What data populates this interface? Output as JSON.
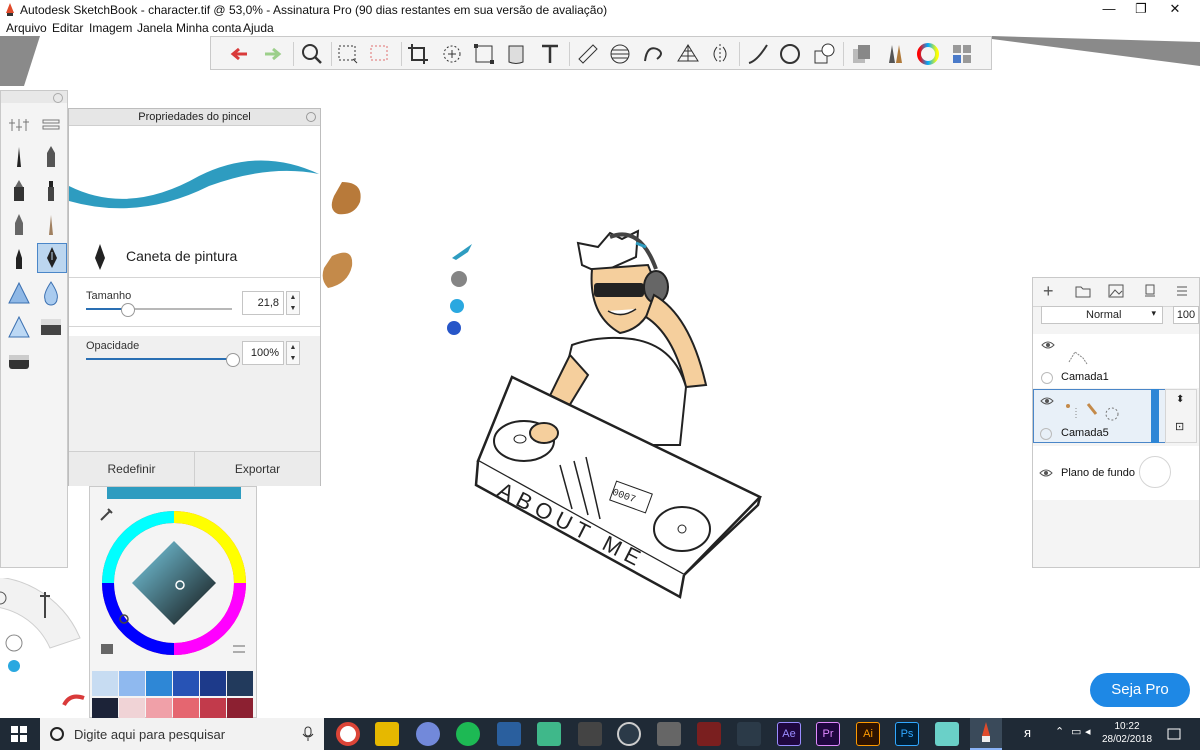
{
  "window": {
    "title": "Autodesk SketchBook - character.tif @ 53,0% - Assinatura Pro (90 dias restantes em sua versão de avaliação)",
    "controls": {
      "minimize": "—",
      "restore": "❐",
      "close": "✕"
    }
  },
  "menu": [
    "Arquivo",
    "Editar",
    "Imagem",
    "Janela",
    "Minha conta",
    "Ajuda"
  ],
  "toolbar": {
    "tools": [
      "undo-icon",
      "redo-icon",
      "zoom-icon",
      "select-rect-icon",
      "lasso-icon",
      "crop-icon",
      "transform-icon",
      "distort-icon",
      "fill-icon",
      "text-icon",
      "ruler-icon",
      "ellipse-guide-icon",
      "french-curve-icon",
      "perspective-icon",
      "symmetry-icon",
      "stroke-icon",
      "ellipse-icon",
      "shapes-icon",
      "copy-icon",
      "brushes-icon",
      "color-wheel-icon",
      "panels-icon"
    ]
  },
  "brush_props": {
    "header": "Propriedades do pincel",
    "brush_name": "Caneta de pintura",
    "size_label": "Tamanho",
    "size_value": "21,8",
    "size_fraction": 0.28,
    "opacity_label": "Opacidade",
    "opacity_value": "100%",
    "opacity_fraction": 1.0,
    "reset_label": "Redefinir",
    "export_label": "Exportar",
    "stroke_color": "#2e9cc0"
  },
  "color_panel": {
    "current_color": "#2e9cc0",
    "swatches": [
      "#c7dcf2",
      "#8fb9ef",
      "#2e87d6",
      "#2753b5",
      "#1d3a8a",
      "#223a5c",
      "#1c2338",
      "#f0d3d6",
      "#f0a0a8",
      "#e56670",
      "#c23a4b",
      "#8c2031"
    ]
  },
  "canvas_swatches": [
    "#2e9cc0",
    "#858585",
    "#2aa8e0",
    "#2756c8"
  ],
  "canvas_blobs": [
    "#b87a3a",
    "#c48a4a"
  ],
  "drawing": {
    "sign_text": "ABOUT ME",
    "display_text": "0007"
  },
  "layers": {
    "blend_mode": "Normal",
    "opacity": "100",
    "items": [
      {
        "name": "Camada1",
        "selected": false
      },
      {
        "name": "Camada5",
        "selected": true
      },
      {
        "name": "Plano de fundo",
        "selected": false
      }
    ]
  },
  "seja_pro": "Seja Pro",
  "taskbar": {
    "search_placeholder": "Digite aqui para pesquisar",
    "time": "10:22",
    "date": "28/02/2018",
    "apps": [
      "Ae",
      "Pr",
      "Ai",
      "Ps"
    ]
  }
}
